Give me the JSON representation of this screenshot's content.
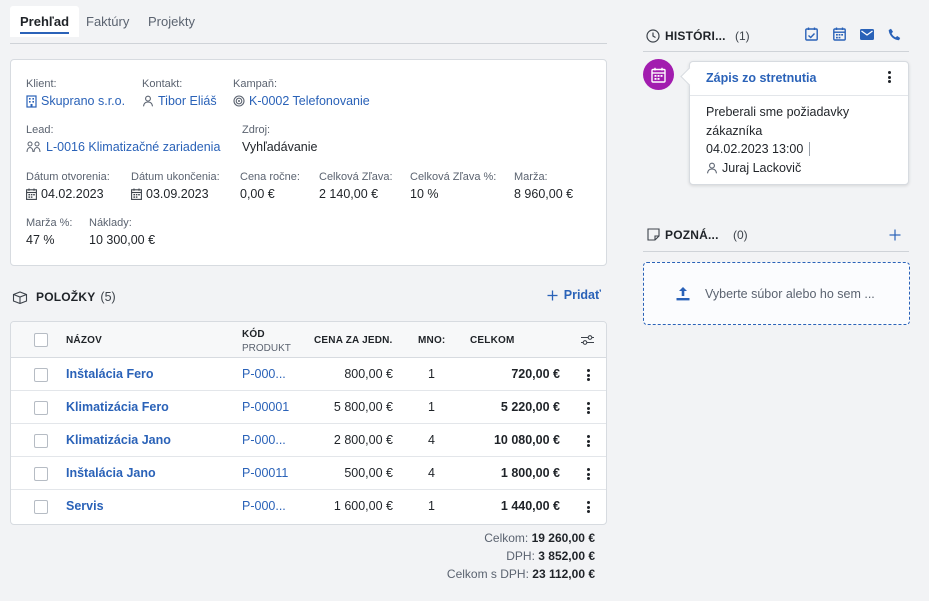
{
  "tabs": [
    {
      "label": "Prehľad"
    },
    {
      "label": "Faktúry"
    },
    {
      "label": "Projekty"
    }
  ],
  "info": {
    "klient": {
      "label": "Klient:",
      "value": "Skuprano s.r.o."
    },
    "kontakt": {
      "label": "Kontakt:",
      "value": "Tibor Eliáš"
    },
    "kampan": {
      "label": "Kampaň:",
      "value": "K-0002 Telefonovanie"
    },
    "lead": {
      "label": "Lead:",
      "value": "L-0016 Klimatizačné zariadenia"
    },
    "zdroj": {
      "label": "Zdroj:",
      "value": "Vyhľadávanie"
    },
    "datum_otvorenia": {
      "label": "Dátum otvorenia:",
      "value": "04.02.2023"
    },
    "datum_ukoncenia": {
      "label": "Dátum ukončenia:",
      "value": "03.09.2023"
    },
    "cena_rocne": {
      "label": "Cena ročne:",
      "value": "0,00 €"
    },
    "celkova_zlava": {
      "label": "Celková Zľava:",
      "value": "2 140,00 €"
    },
    "celkova_zlava_pct": {
      "label": "Celková Zľava %:",
      "value": "10 %"
    },
    "marza": {
      "label": "Marža:",
      "value": "8 960,00 €"
    },
    "marza_pct": {
      "label": "Marža %:",
      "value": "47 %"
    },
    "naklady": {
      "label": "Náklady:",
      "value": "10 300,00 €"
    }
  },
  "items": {
    "title": "POLOŽKY",
    "count": "(5)",
    "add_label": "Pridať",
    "columns": {
      "nazov": "NÁZOV",
      "kod": "KÓD",
      "kod_sub": "PRODUKT",
      "cena": "CENA ZA JEDN.",
      "mnozstvo": "MNO:",
      "celkom": "CELKOM"
    },
    "rows": [
      {
        "name": "Inštalácia Fero",
        "code": "P-000...",
        "price": "800,00 €",
        "qty": "1",
        "total": "720,00 €"
      },
      {
        "name": "Klimatizácia Fero",
        "code": "P-00001",
        "price": "5 800,00 €",
        "qty": "1",
        "total": "5 220,00 €"
      },
      {
        "name": "Klimatizácia Jano",
        "code": "P-000...",
        "price": "2 800,00 €",
        "qty": "4",
        "total": "10 080,00 €"
      },
      {
        "name": "Inštalácia Jano",
        "code": "P-00011",
        "price": "500,00 €",
        "qty": "4",
        "total": "1 800,00 €"
      },
      {
        "name": "Servis",
        "code": "P-000...",
        "price": "1 600,00 €",
        "qty": "1",
        "total": "1 440,00 €"
      }
    ]
  },
  "totals": {
    "celkom_label": "Celkom:",
    "celkom": "19 260,00 €",
    "dph_label": "DPH:",
    "dph": "3 852,00 €",
    "sdph_label": "Celkom s DPH:",
    "sdph": "23 112,00 €"
  },
  "history": {
    "title": "HISTÓRI...",
    "count": "(1)",
    "entry": {
      "title": "Zápis zo stretnutia",
      "text": "Preberali sme požiadavky zákazníka",
      "datetime": "04.02.2023 13:00",
      "user": "Juraj Lackovič"
    }
  },
  "notes": {
    "title": "POZNÁ...",
    "count": "(0)",
    "drop_text": "Vyberte súbor alebo ho sem ..."
  },
  "colors": {
    "accent": "#2a62b8",
    "history_dot": "#a21caf"
  }
}
